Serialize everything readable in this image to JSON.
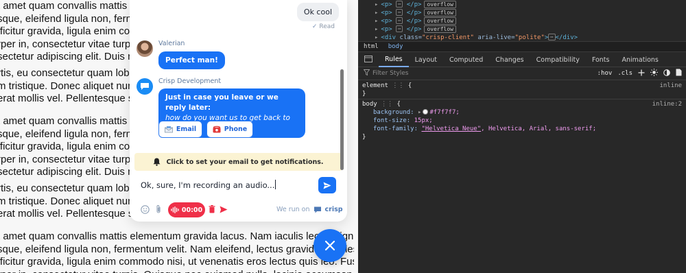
{
  "background_page": {
    "paragraphs": [
      [
        "t amet quam convallis mattis element",
        "sque, eleifend ligula non, fermentum",
        "fficitur gravida, ligula enim commodo",
        "rper in, consectetur vitae turpis. Quis",
        "sectetur adipiscing elit. Duis nulla au"
      ],
      [
        "rtis, eu consectetur quam lobortis. Al",
        "m tristique. Donec aliquet nunc lore",
        "erat mollis vel. Pellentesque sed met"
      ],
      [
        "t amet quam convallis mattis element",
        "sque, eleifend ligula non, fermentum",
        "fficitur gravida, ligula enim commodo",
        "rper in, consectetur vitae turpis. Quis",
        "sectetur adipiscing elit. Duis nulla au"
      ],
      [
        "rtis, eu consectetur quam lobortis. Al",
        "m tristique. Donec aliquet nunc lore",
        "erat mollis vel. Pellentesque sed met"
      ],
      [
        "t amet quam convallis mattis elementum gravida lacus. Nam iaculis leo et dignissim com",
        "sque, eleifend ligula non, fermentum velit. Nam eleifend, lectus gravida sodales fringill",
        "fficitur gravida, ligula enim commodo nisi, ut venenatis eros lectus quis leo. Fusce varius",
        "rper in, consectetur vitae turpis. Quisque nec euismod nulla, lacinia accumsan nisl. Maecenas"
      ]
    ]
  },
  "chat": {
    "user_message": "Ok cool",
    "read_status": "Read",
    "operator1": {
      "name": "Valerian",
      "message": "Perfect man!"
    },
    "operator2": {
      "name": "Crisp Development",
      "message_line1": "Just in case you leave or we reply later:",
      "message_line2": "how do you want us to get back to you?"
    },
    "buttons": {
      "email": "Email",
      "phone": "Phone"
    },
    "notify_text": "Click to set your email to get notifications.",
    "composer_value": "Ok, sure, I'm recording an audio...",
    "recording_time": "00:00",
    "run_on_label": "We run on",
    "brand_name": "crisp",
    "accent_color": "#1972f5",
    "record_color": "#ef2f48"
  },
  "devtools": {
    "dom_lines": [
      {
        "tag_open": "<p>",
        "tag_close": "</p>",
        "badge": "overflow"
      },
      {
        "tag_open": "<p>",
        "tag_close": "</p>",
        "badge": "overflow"
      },
      {
        "tag_open": "<p>",
        "tag_close": "</p>",
        "badge": "overflow"
      },
      {
        "tag_open": "<p>",
        "tag_close": "</p>",
        "badge": "overflow"
      }
    ],
    "dom_div_line": {
      "open": "<div",
      "class_attr": "class=",
      "class_val": "\"crisp-client\"",
      "aria_attr": "aria-live=",
      "aria_val": "\"polite\"",
      "close": "</div>"
    },
    "breadcrumbs": [
      "html",
      "body"
    ],
    "tabs": [
      "Rules",
      "Layout",
      "Computed",
      "Changes",
      "Compatibility",
      "Fonts",
      "Animations"
    ],
    "active_tab": "Rules",
    "filter_placeholder": "Filter Styles",
    "filter_tools": {
      "hov": ":hov",
      "cls": ".cls"
    },
    "rules": {
      "element_selector": "element",
      "element_open": "{",
      "element_close": "}",
      "element_source": "inline",
      "body_selector": "body",
      "body_open": "{",
      "body_close": "}",
      "body_source": "inline:2",
      "bg_prop": "background:",
      "bg_val": "#f7f7f7;",
      "fs_prop": "font-size:",
      "fs_val": "15px;",
      "ff_prop": "font-family:",
      "ff_val_quoted": "\"Helvetica Neue\"",
      "ff_val_rest": ", Helvetica, Arial, sans-serif;"
    }
  }
}
